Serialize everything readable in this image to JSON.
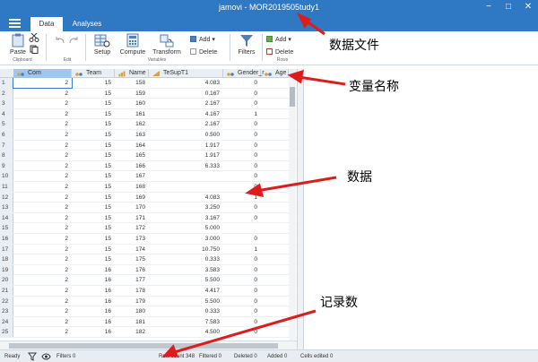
{
  "title": {
    "text": "jamovi - MOR2019505tudy1"
  },
  "window": {
    "min": "−",
    "max": "□",
    "close": "✕"
  },
  "tabs": [
    {
      "label": "Data"
    },
    {
      "label": "Analyses"
    }
  ],
  "ribbon": {
    "paste": "Paste",
    "clipboard": "Clipboard",
    "edit": "Edit",
    "setup": "Setup",
    "compute": "Compute",
    "transform": "Transform",
    "variables": "Variables",
    "add1": "Add ▾",
    "delete1": "Delete",
    "filters": "Filters",
    "add2": "Add ▾",
    "delete2": "Delete",
    "rows": "Rows"
  },
  "columns": [
    {
      "name": "Com",
      "type": "nominal",
      "selected": true
    },
    {
      "name": "Team",
      "type": "nominal",
      "selected": false
    },
    {
      "name": "Name",
      "type": "ordinal",
      "selected": false
    },
    {
      "name": "TeSupT1",
      "type": "continuous",
      "selected": false
    },
    {
      "name": "Gender_r",
      "type": "nominal",
      "selected": false
    },
    {
      "name": "Age",
      "type": "nominal",
      "selected": false
    }
  ],
  "rows": [
    [
      1,
      2,
      15,
      158,
      "4.083",
      "0"
    ],
    [
      2,
      2,
      15,
      159,
      "0.167",
      "0"
    ],
    [
      3,
      2,
      15,
      160,
      "2.167",
      "0"
    ],
    [
      4,
      2,
      15,
      161,
      "4.167",
      "1"
    ],
    [
      5,
      2,
      15,
      162,
      "2.167",
      "0"
    ],
    [
      6,
      2,
      15,
      163,
      "0.500",
      "0"
    ],
    [
      7,
      2,
      15,
      164,
      "1.917",
      "0"
    ],
    [
      8,
      2,
      15,
      165,
      "1.917",
      "0"
    ],
    [
      9,
      2,
      15,
      166,
      "6.333",
      "0"
    ],
    [
      10,
      2,
      15,
      167,
      "",
      "0"
    ],
    [
      11,
      2,
      15,
      168,
      "",
      "0"
    ],
    [
      12,
      2,
      15,
      169,
      "4.083",
      "1"
    ],
    [
      13,
      2,
      15,
      170,
      "3.250",
      "0"
    ],
    [
      14,
      2,
      15,
      171,
      "3.167",
      "0"
    ],
    [
      15,
      2,
      15,
      172,
      "5.000",
      ""
    ],
    [
      16,
      2,
      15,
      173,
      "3.000",
      "0"
    ],
    [
      17,
      2,
      15,
      174,
      "10.750",
      "1"
    ],
    [
      18,
      2,
      15,
      175,
      "0.333",
      "0"
    ],
    [
      19,
      2,
      16,
      176,
      "3.583",
      "0"
    ],
    [
      20,
      2,
      16,
      177,
      "5.500",
      "0"
    ],
    [
      21,
      2,
      16,
      178,
      "4.417",
      "0"
    ],
    [
      22,
      2,
      16,
      179,
      "5.500",
      "0"
    ],
    [
      23,
      2,
      16,
      180,
      "0.333",
      "0"
    ],
    [
      24,
      2,
      16,
      181,
      "7.583",
      "0"
    ],
    [
      25,
      2,
      16,
      182,
      "4.500",
      "0"
    ]
  ],
  "status": {
    "ready": "Ready",
    "filters": "Filters 0",
    "rowcount": "Row count 348",
    "filtered": "Filtered 0",
    "deleted": "Deleted 0",
    "added": "Added 0",
    "cells": "Cells edited 0"
  },
  "annotations": {
    "file": "数据文件",
    "vars": "变量名称",
    "data": "数据",
    "records": "记录数"
  },
  "colors": {
    "accent": "#2f78c4",
    "arrow": "#e01b1b"
  }
}
